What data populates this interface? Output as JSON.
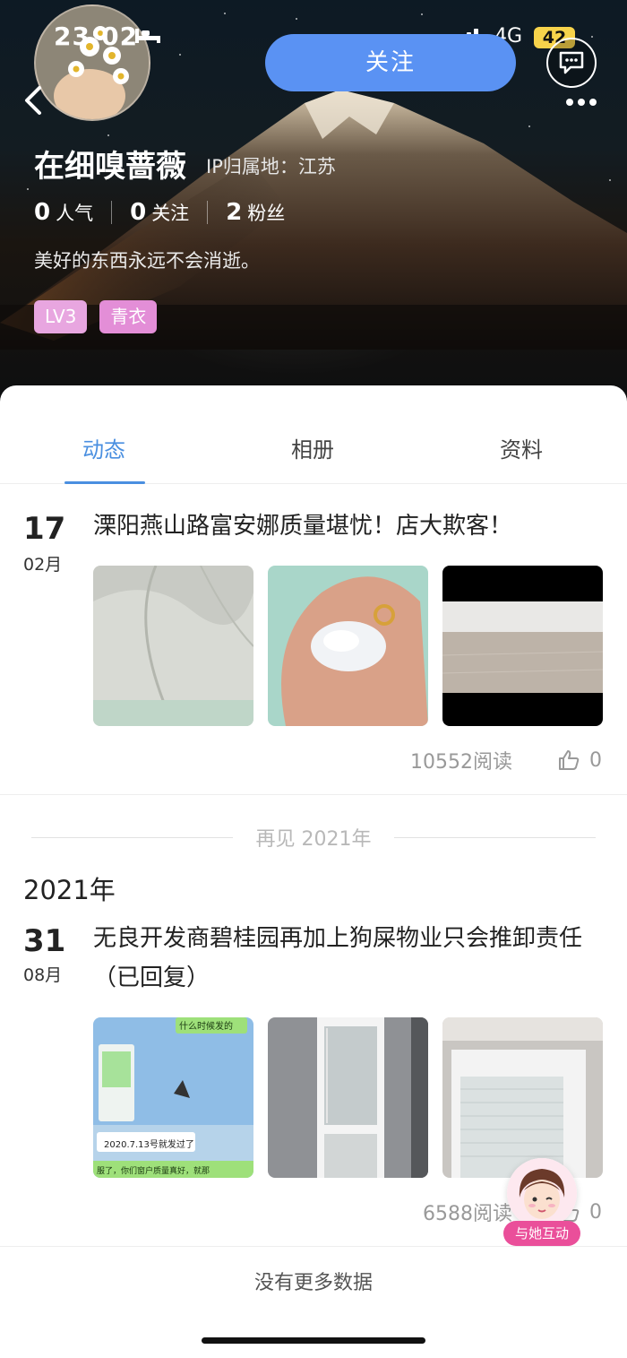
{
  "status_bar": {
    "time": "23:02",
    "network": "4G",
    "battery": "42"
  },
  "profile": {
    "name": "在细嗅蔷薇",
    "ip_location": "IP归属地：江苏",
    "stats": [
      {
        "value": "0",
        "label": "人气"
      },
      {
        "value": "0",
        "label": "关注"
      },
      {
        "value": "2",
        "label": "粉丝"
      }
    ],
    "bio": "美好的东西永远不会消逝。",
    "badges": [
      "LV3",
      "青衣"
    ],
    "follow_label": "关注"
  },
  "tabs": [
    {
      "label": "动态",
      "active": true
    },
    {
      "label": "相册",
      "active": false
    },
    {
      "label": "资料",
      "active": false
    }
  ],
  "posts": [
    {
      "day": "17",
      "month": "02月",
      "title": "溧阳燕山路富安娜质量堪忧！店大欺客！",
      "reads": "10552阅读",
      "likes": "0"
    },
    {
      "day": "31",
      "month": "08月",
      "title": "无良开发商碧桂园再加上狗屎物业只会推卸责任（已回复）",
      "reads": "6588阅读",
      "likes": "0",
      "image_texts": [
        "什么时候发的",
        "2020.7.13号就发过了",
        "服了，你们窗户质量真好，就那"
      ]
    }
  ],
  "year_separator": "再见 2021年",
  "year_heading": "2021年",
  "footer": {
    "no_more": "没有更多数据"
  },
  "interact": {
    "label": "与她互动"
  },
  "colors": {
    "accent": "#4a8fe0",
    "follow_button": "#5a92f3",
    "badge": "#e38ed7",
    "interact": "#ea4f9a"
  },
  "icons": [
    "bed-icon",
    "signal-icon",
    "back-icon",
    "chat-icon",
    "more-icon",
    "thumbs-up-icon"
  ]
}
